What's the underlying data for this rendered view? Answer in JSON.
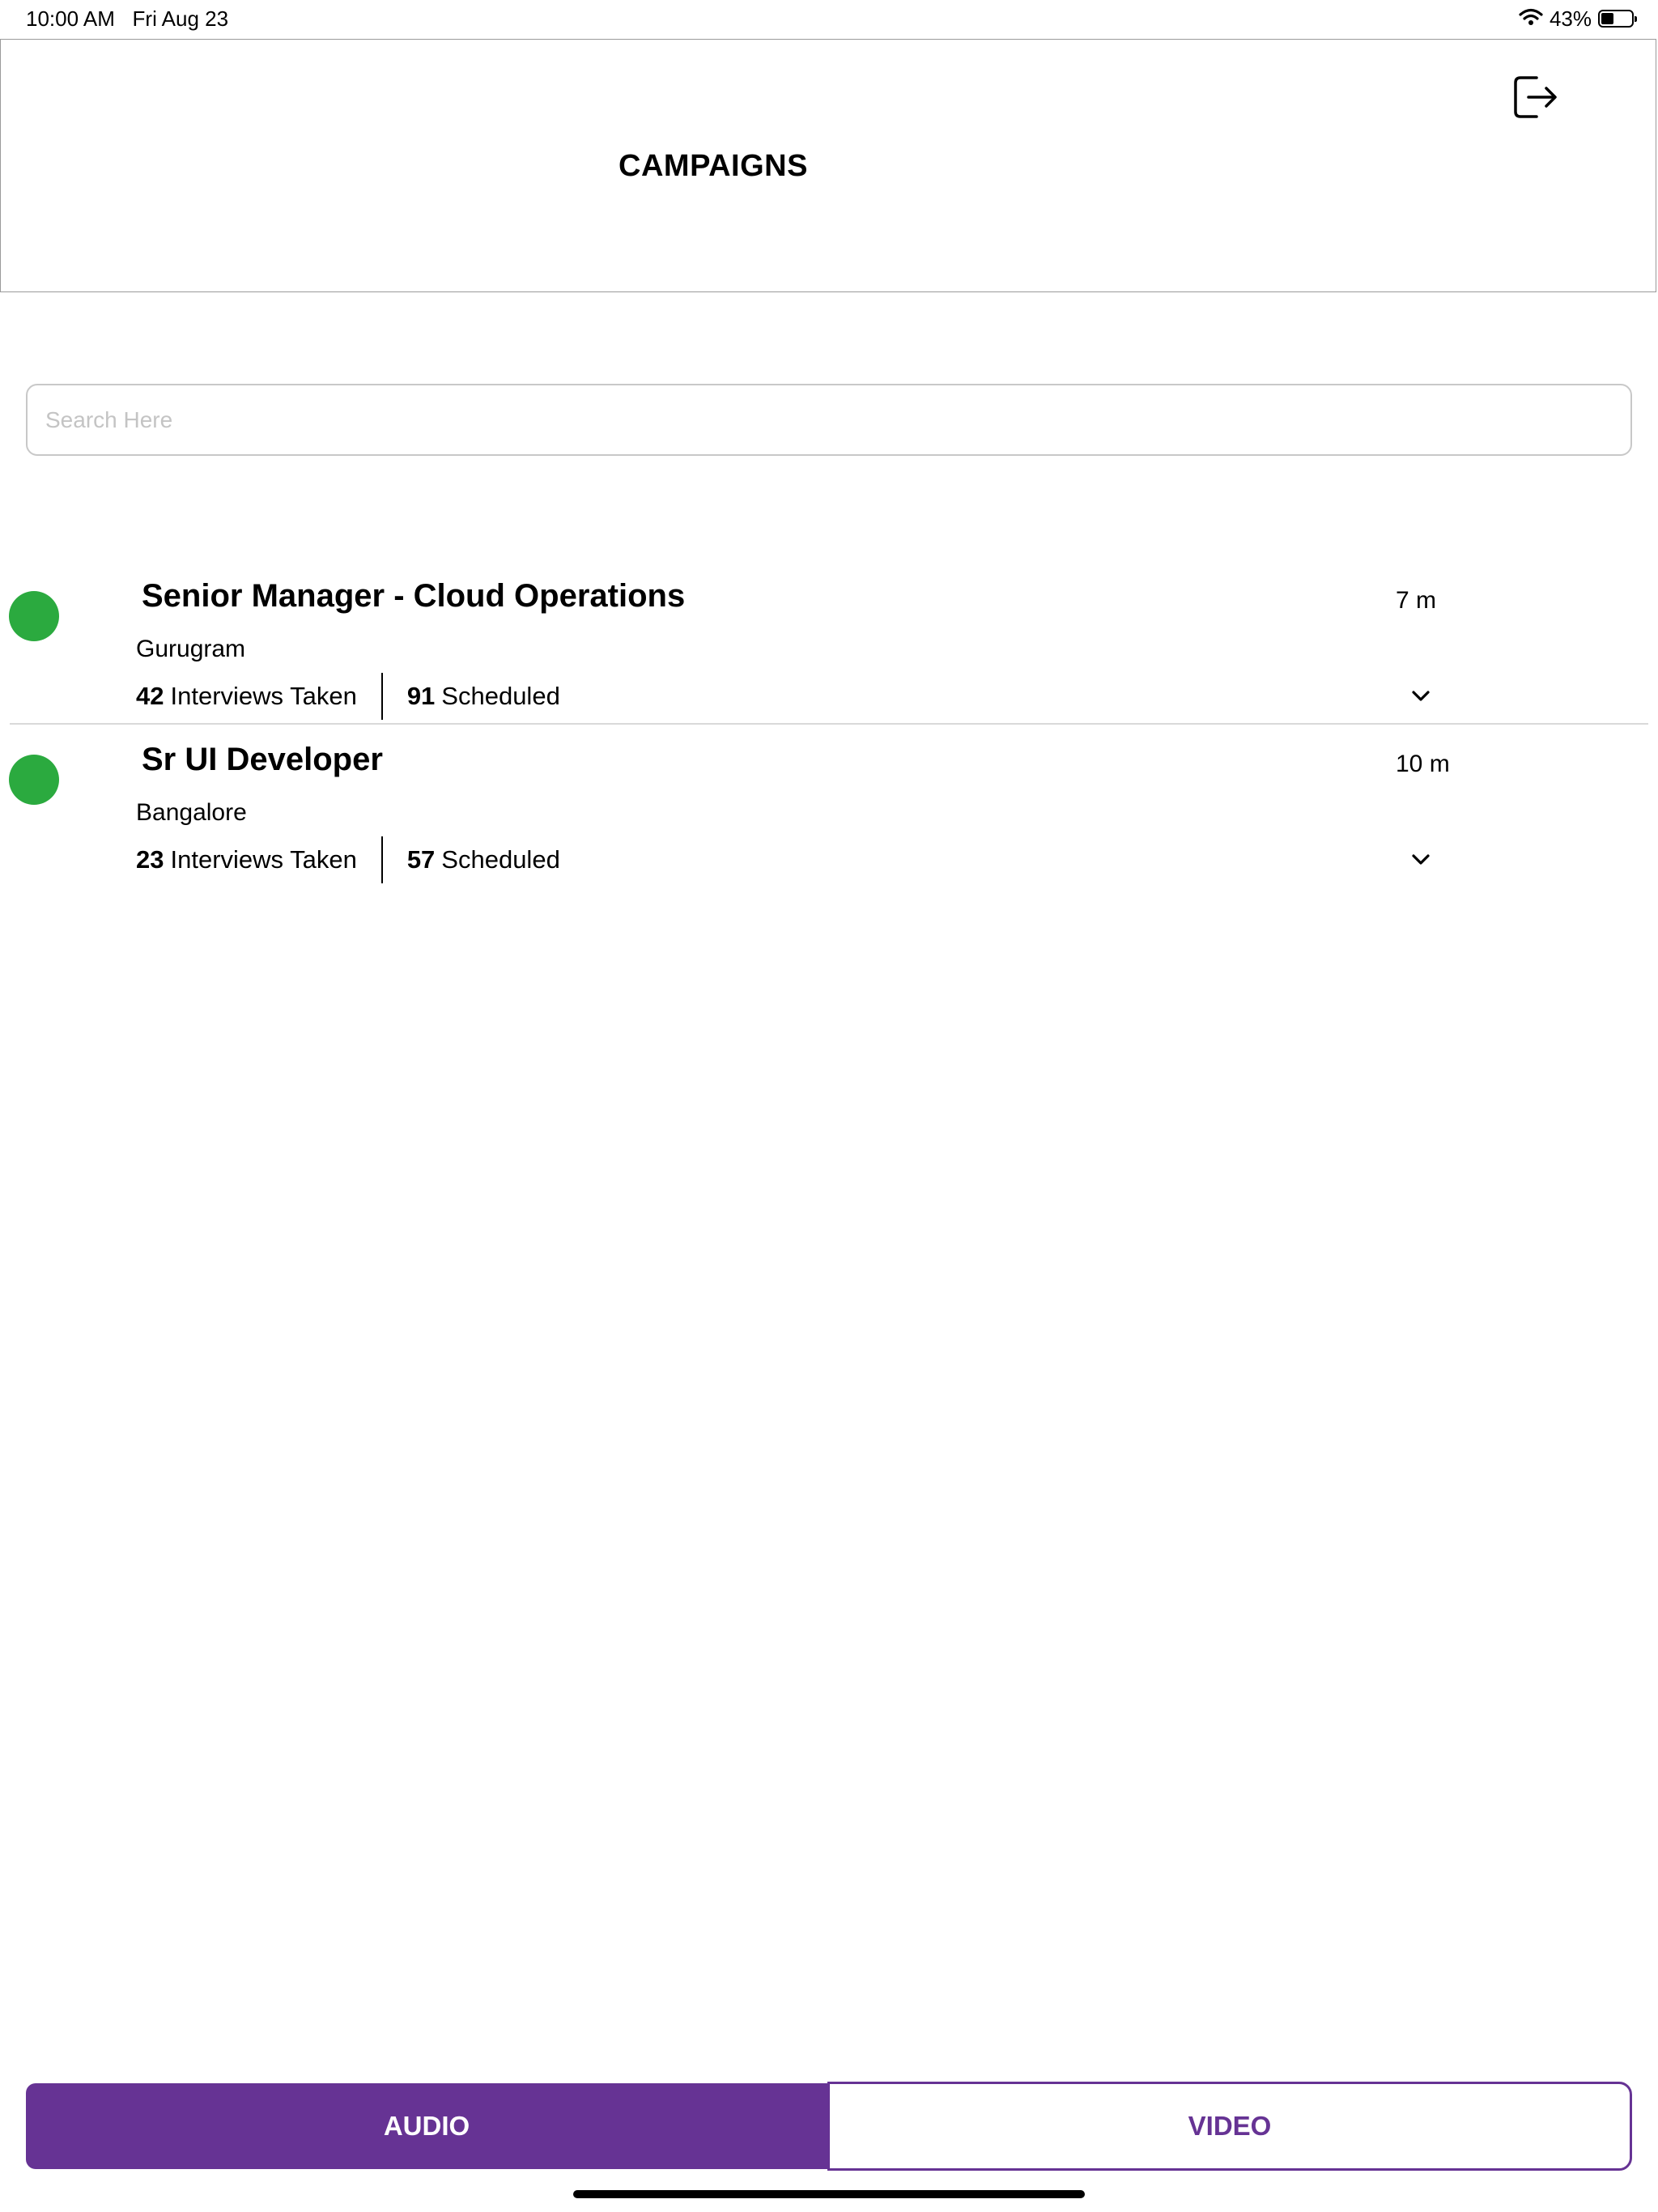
{
  "status_bar": {
    "time": "10:00 AM",
    "date": "Fri Aug 23",
    "wifi_icon": "wifi-icon",
    "battery_percent": "43%",
    "battery_level": 0.43
  },
  "header": {
    "title": "CAMPAIGNS",
    "logout_icon": "logout-icon"
  },
  "search": {
    "placeholder": "Search Here",
    "value": ""
  },
  "campaigns": [
    {
      "title": "Senior Manager - Cloud Operations",
      "time": "7 m",
      "location": "Gurugram",
      "interviews_taken": "42",
      "interviews_label": "Interviews Taken",
      "scheduled": "91",
      "scheduled_label": "Scheduled",
      "status_color": "#2BAA3F",
      "expand_icon": "chevron-down-icon"
    },
    {
      "title": "Sr UI Developer",
      "time": "10 m",
      "location": "Bangalore",
      "interviews_taken": "23",
      "interviews_label": "Interviews Taken",
      "scheduled": "57",
      "scheduled_label": "Scheduled",
      "status_color": "#2BAA3F",
      "expand_icon": "chevron-down-icon"
    }
  ],
  "tabs": {
    "audio_label": "AUDIO",
    "video_label": "VIDEO",
    "selected": "AUDIO"
  },
  "colors": {
    "accent": "#663394",
    "status_active": "#2BAA3F"
  }
}
